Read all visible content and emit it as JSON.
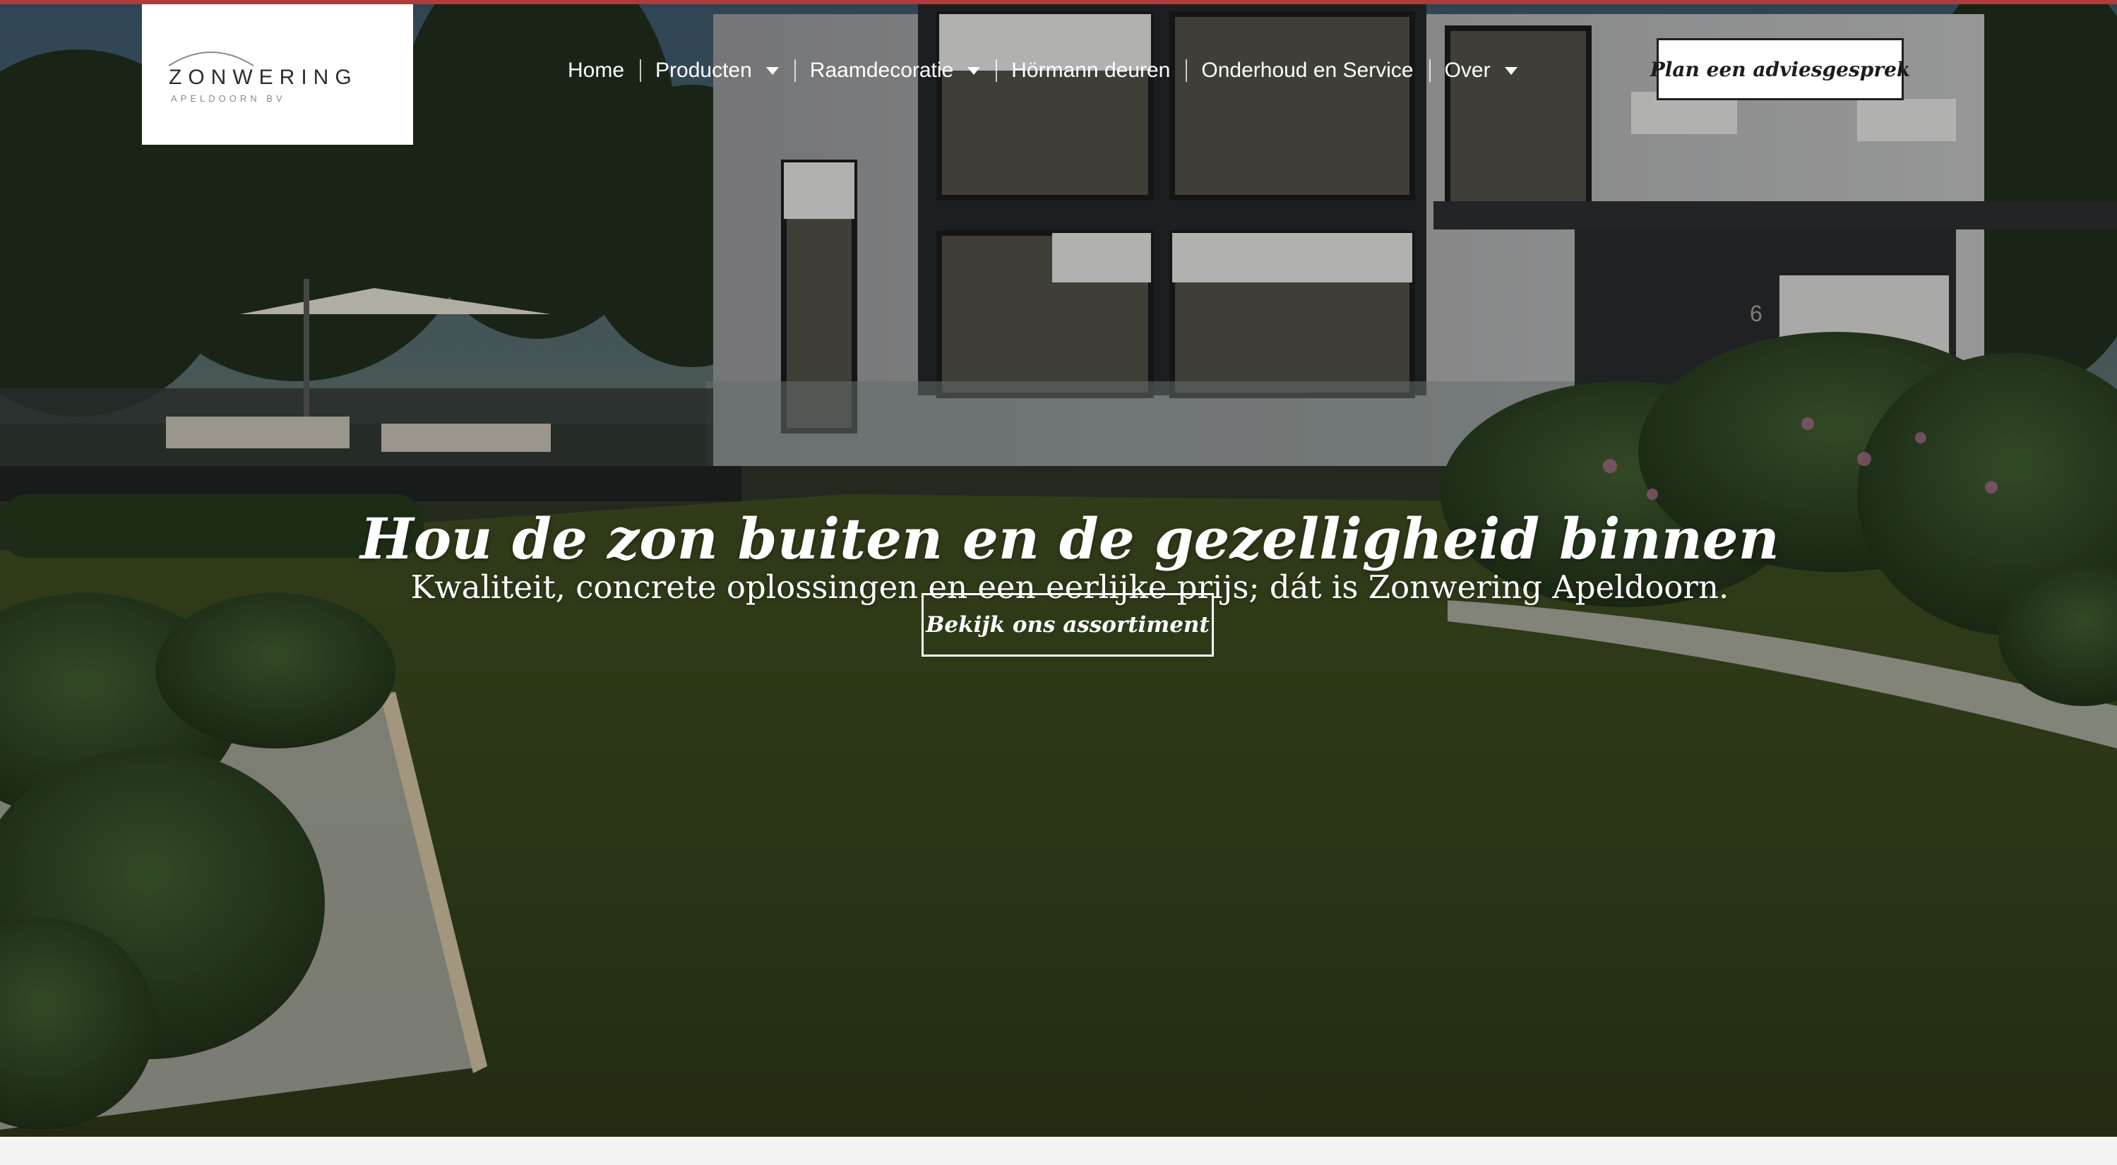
{
  "brand": {
    "logo_text": "ZONWERING",
    "logo_subtext": "APELDOORN BV",
    "accent_color": "#b23a3a"
  },
  "nav": {
    "items": [
      {
        "label": "Home",
        "has_dropdown": false
      },
      {
        "label": "Producten",
        "has_dropdown": true
      },
      {
        "label": "Raamdecoratie",
        "has_dropdown": true
      },
      {
        "label": "Hörmann deuren",
        "has_dropdown": false
      },
      {
        "label": "Onderhoud en Service",
        "has_dropdown": false
      },
      {
        "label": "Over",
        "has_dropdown": true
      }
    ],
    "cta_label": "Plan een adviesgesprek"
  },
  "hero": {
    "title": "Hou de zon buiten en de gezelligheid binnen",
    "subtitle": "Kwaliteit, concrete oplossingen en een eerlijke prijs; dát is Zonwering Apeldoorn.",
    "cta_label": "Bekijk ons assortiment",
    "house_number": "6",
    "background_image": "modern-house-with-garden-photo"
  }
}
